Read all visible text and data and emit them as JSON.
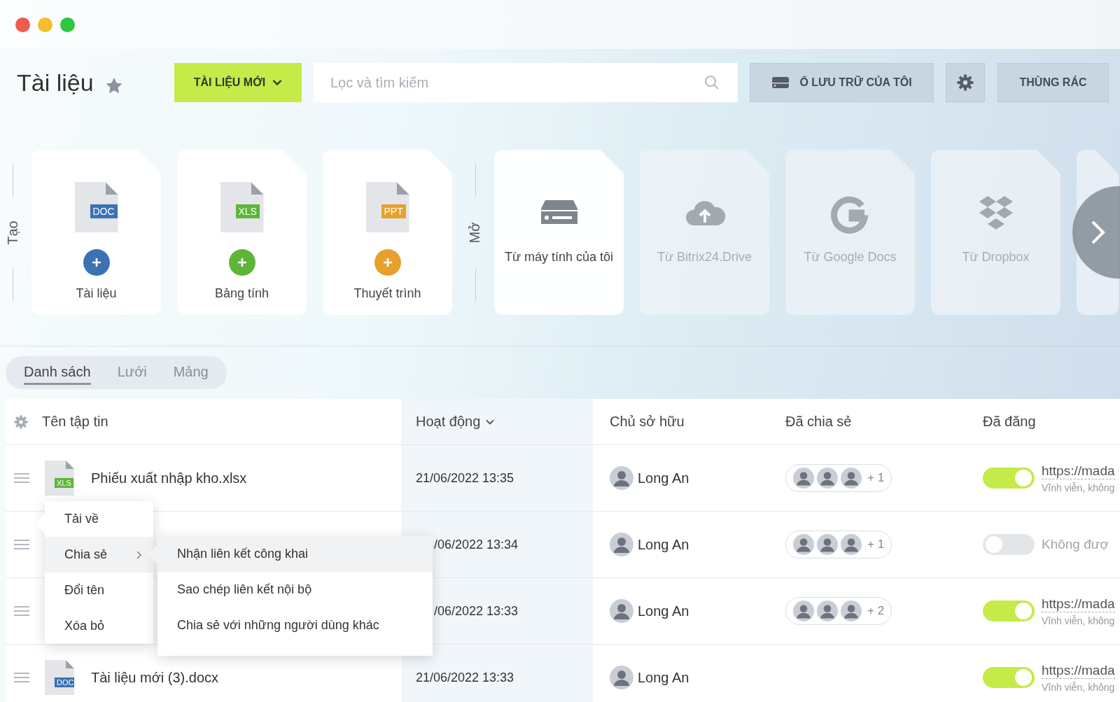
{
  "window": {
    "controls": [
      {
        "color": "#ee5c50"
      },
      {
        "color": "#f6bd2f"
      },
      {
        "color": "#2bc840"
      }
    ]
  },
  "header": {
    "title": "Tài liệu",
    "new_button": "TÀI LIỆU MỚI",
    "search": {
      "placeholder": "Lọc và tìm kiếm"
    },
    "storage_button": "Ổ LƯU TRỮ CỦA TÔI",
    "trash_button": "THÙNG RÁC"
  },
  "create": {
    "label": "Tạo",
    "items": [
      {
        "tag": "DOC",
        "color": "#3a72b4",
        "label": "Tài liệu"
      },
      {
        "tag": "XLS",
        "color": "#5fb43a",
        "label": "Bảng tính"
      },
      {
        "tag": "PPT",
        "color": "#e7a02c",
        "label": "Thuyết trình"
      }
    ]
  },
  "open": {
    "label": "Mở",
    "items": [
      {
        "kind": "computer",
        "label": "Từ máy tính của tôi",
        "disabled": false
      },
      {
        "kind": "cloud",
        "label": "Từ Bitrix24.Drive",
        "disabled": true
      },
      {
        "kind": "google",
        "label": "Từ Google Docs",
        "disabled": true
      },
      {
        "kind": "dropbox",
        "label": "Từ Dropbox",
        "disabled": true
      },
      {
        "kind": "other",
        "disabled": true
      }
    ]
  },
  "views": [
    {
      "label": "Danh sách",
      "selected": true
    },
    {
      "label": "Lưới",
      "selected": false
    },
    {
      "label": "Mảng",
      "selected": false
    }
  ],
  "table": {
    "columns": [
      {
        "label": "Tên tập tin",
        "sorted": false
      },
      {
        "label": "Hoạt động",
        "sorted": true
      },
      {
        "label": "Chủ sở hữu",
        "sorted": false
      },
      {
        "label": "Đã chia sẻ",
        "sorted": false
      },
      {
        "label": "Đã đăng",
        "sorted": false
      }
    ],
    "rows": [
      {
        "type": "XLS",
        "name": "Phiếu xuất nhập kho.xlsx",
        "activity": "21/06/2022 13:35",
        "owner": "Long An",
        "shared": {
          "extra": "+ 1"
        },
        "published": {
          "on": true,
          "link": "https://mada",
          "note": "Vĩnh viễn, không"
        }
      },
      {
        "activity": "/06/2022 13:34",
        "owner": "Long An",
        "shared": {
          "extra": "+ 1"
        },
        "published": {
          "on": false,
          "status": "Không đượ"
        }
      },
      {
        "activity": "/06/2022 13:33",
        "owner": "Long An",
        "shared": {
          "extra": "+ 2"
        },
        "published": {
          "on": true,
          "link": "https://mada",
          "note": "Vĩnh viễn, không"
        }
      },
      {
        "type": "DOC",
        "name": "Tài liệu mới (3).docx",
        "activity": "21/06/2022 13:33",
        "owner": "Long An",
        "published": {
          "on": true,
          "link": "https://mada",
          "note": "Vĩnh viễn, không"
        }
      }
    ]
  },
  "context_menu": {
    "items": [
      {
        "label": "Tải về",
        "selected": false,
        "submenu": false
      },
      {
        "label": "Chia sẻ",
        "selected": true,
        "submenu": true
      },
      {
        "label": "Đổi tên",
        "selected": false,
        "submenu": false
      },
      {
        "label": "Xóa bỏ",
        "selected": false,
        "submenu": false
      }
    ],
    "submenu": {
      "items": [
        {
          "label": "Nhận liên kết công khai",
          "selected": true
        },
        {
          "label": "Sao chép liên kết nội bộ",
          "selected": false
        },
        {
          "label": "Chia sẻ với những người dùng khác",
          "selected": false
        }
      ]
    }
  }
}
